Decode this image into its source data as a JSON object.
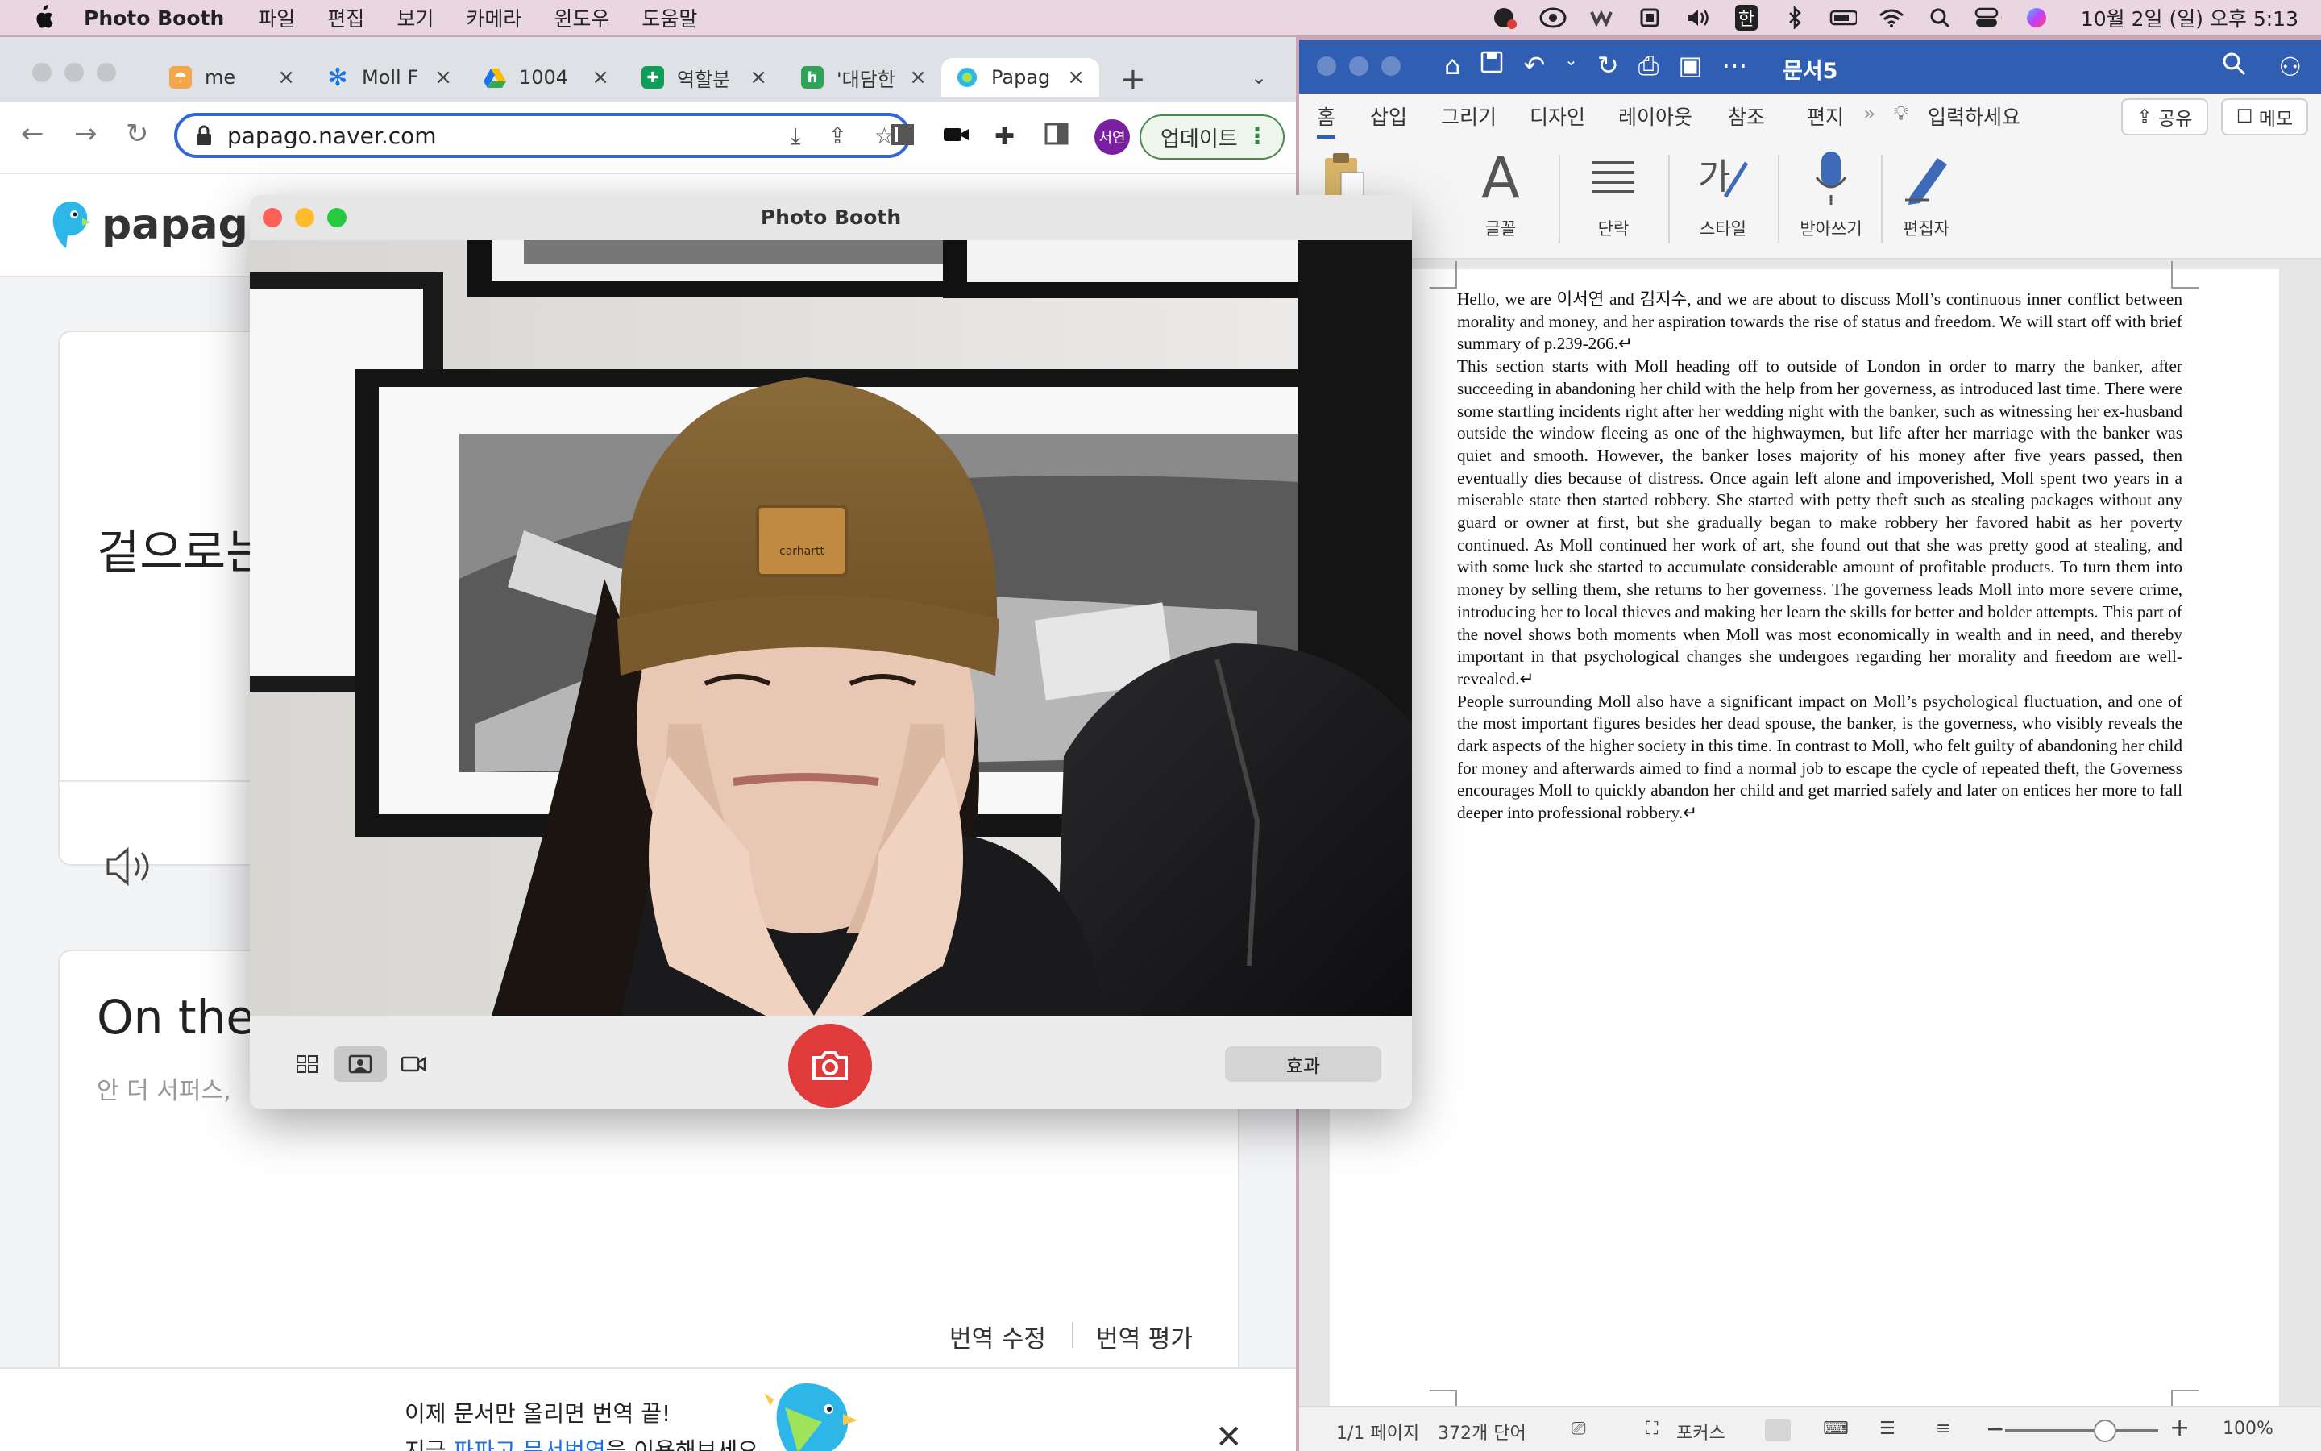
{
  "menubar": {
    "app_name": "Photo Booth",
    "items": [
      "파일",
      "편집",
      "보기",
      "카메라",
      "윈도우",
      "도움말"
    ],
    "clock": "10월 2일 (일) 오후 5:13",
    "status_icons": [
      "messenger-icon",
      "creative-cloud-icon",
      "wacom-icon",
      "screen-record-icon",
      "volume-icon",
      "input-korean-icon",
      "bluetooth-icon",
      "battery-icon",
      "wifi-icon",
      "spotlight-icon",
      "control-center-icon",
      "siri-icon"
    ],
    "input_source": "한"
  },
  "chrome": {
    "tabs": [
      {
        "title": "me",
        "favicon": "umbrella-icon",
        "color": "#e87b2e"
      },
      {
        "title": "Moll F",
        "favicon": "asterisk-icon",
        "color": "#1a73e8"
      },
      {
        "title": "1004",
        "favicon": "google-drive-icon",
        "color": "#fbbc04"
      },
      {
        "title": "역할분",
        "favicon": "google-sheets-icon",
        "color": "#0f9d58"
      },
      {
        "title": "'대담한",
        "favicon": "sheet-icon",
        "color": "#2fa35a"
      },
      {
        "title": "Papag",
        "favicon": "papago-icon",
        "color": "#29a9e0"
      }
    ],
    "url": "papago.naver.com",
    "profile_initials": "서연",
    "update_label": "업데이트"
  },
  "papago": {
    "brand": "papago",
    "source_text_partial": "겉으로는",
    "translation_partial": "On the",
    "hint_partial": "안 더 서퍼스, ",
    "fix_label": "번역 수정",
    "rate_label": "번역 평가",
    "banner_line1": "이제 문서만 올리면 번역 끝!",
    "banner_line2_prefix": "지금 ",
    "banner_line2_link": "파파고 문서번역",
    "banner_line2_suffix": "을 이용해보세요."
  },
  "photobooth": {
    "title": "Photo Booth",
    "effects_label": "효과",
    "modes": [
      "grid-view-icon",
      "single-photo-icon",
      "video-icon"
    ],
    "selected_mode": "single-photo-icon",
    "hat_label": "carhartt"
  },
  "word": {
    "doc_title": "문서5",
    "ribbon_tabs": [
      "홈",
      "삽입",
      "그리기",
      "디자인",
      "레이아웃",
      "참조",
      "편지"
    ],
    "tell_me": "입력하세요",
    "share_label": "공유",
    "memo_label": "메모",
    "groups": [
      {
        "label": "글꼴",
        "icon": "font-icon"
      },
      {
        "label": "단락",
        "icon": "paragraph-icon"
      },
      {
        "label": "스타일",
        "icon": "styles-icon"
      },
      {
        "label": "받아쓰기",
        "icon": "microphone-icon"
      },
      {
        "label": "편집자",
        "icon": "editor-icon"
      }
    ],
    "paragraphs": [
      "Hello, we are 이서연 and 김지수, and we are about to discuss Moll’s continuous inner conflict between morality and money, and her aspiration towards the rise of status and freedom. We will start off with brief summary of p.239-266.↵",
      "This section starts with Moll heading off to outside of London in order to marry the banker, after succeeding in abandoning her child with the help from her governess, as introduced last time. There were some startling incidents right after her wedding night with the banker, such as witnessing her ex-husband outside the window fleeing as one of the highwaymen, but life after her marriage with the banker was quiet and smooth. However, the banker loses majority of his money after five years passed, then eventually dies because of distress. Once again left alone and impoverished, Moll spent two years in a miserable state then started robbery. She started with petty theft such as stealing packages without any guard or owner at first, but she gradually began to make robbery her favored habit as her poverty continued. As Moll continued her work of art, she found out that she was pretty good at stealing, and with some luck she started to accumulate considerable amount of profitable products. To turn them into money by selling them, she returns to her governess. The governess leads Moll into more severe crime, introducing her to local thieves and making her learn the skills for better and bolder attempts. This part of the novel shows both moments when Moll was most economically in wealth and in need, and thereby important in that psychological changes she undergoes regarding her morality and freedom are well-revealed.↵",
      "People surrounding Moll also have a significant impact on Moll’s psychological fluctuation, and one of the most important figures besides her dead spouse, the banker, is the governess, who visibly reveals the dark aspects of the higher society in this time. In contrast to Moll, who felt guilty of abandoning her child for money and afterwards aimed to find a normal job to escape the cycle of repeated theft, the Governess encourages Moll to quickly abandon her child and get married safely and later on entices her more to fall deeper into professional robbery.↵"
    ],
    "status": {
      "pages": "1/1 페이지",
      "words": "372개 단어",
      "focus": "포커스",
      "zoom": "100%"
    }
  }
}
